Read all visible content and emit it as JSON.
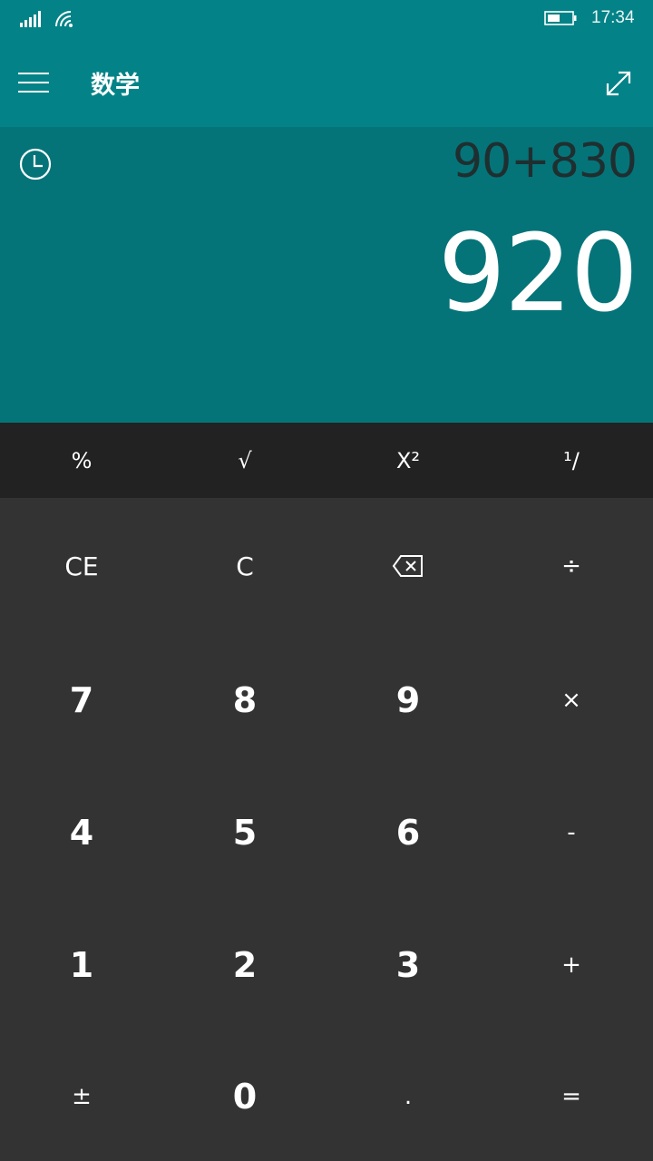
{
  "status_bar": {
    "time": "17:34",
    "icons": [
      "signal-icon",
      "wifi-icon",
      "battery-icon"
    ]
  },
  "header": {
    "title": "数学",
    "menu_icon": "hamburger-menu-icon",
    "expand_icon": "expand-arrows-icon"
  },
  "display": {
    "history_icon": "history-clock-icon",
    "expression": "90+830",
    "result": "920"
  },
  "scientific_row": [
    "%",
    "√",
    "X²",
    "¹∕"
  ],
  "keypad": {
    "ce": "CE",
    "c": "C",
    "backspace_icon": "backspace-icon",
    "divide": "÷",
    "seven": "7",
    "eight": "8",
    "nine": "9",
    "multiply": "×",
    "four": "4",
    "five": "5",
    "six": "6",
    "minus": "-",
    "one": "1",
    "two": "2",
    "three": "3",
    "plus": "+",
    "negate": "±",
    "zero": "0",
    "decimal": ".",
    "equals": "="
  },
  "colors": {
    "accent": "#038387",
    "display_bg": "#047479",
    "sci_row_bg": "#222222",
    "keypad_bg": "#333333"
  }
}
